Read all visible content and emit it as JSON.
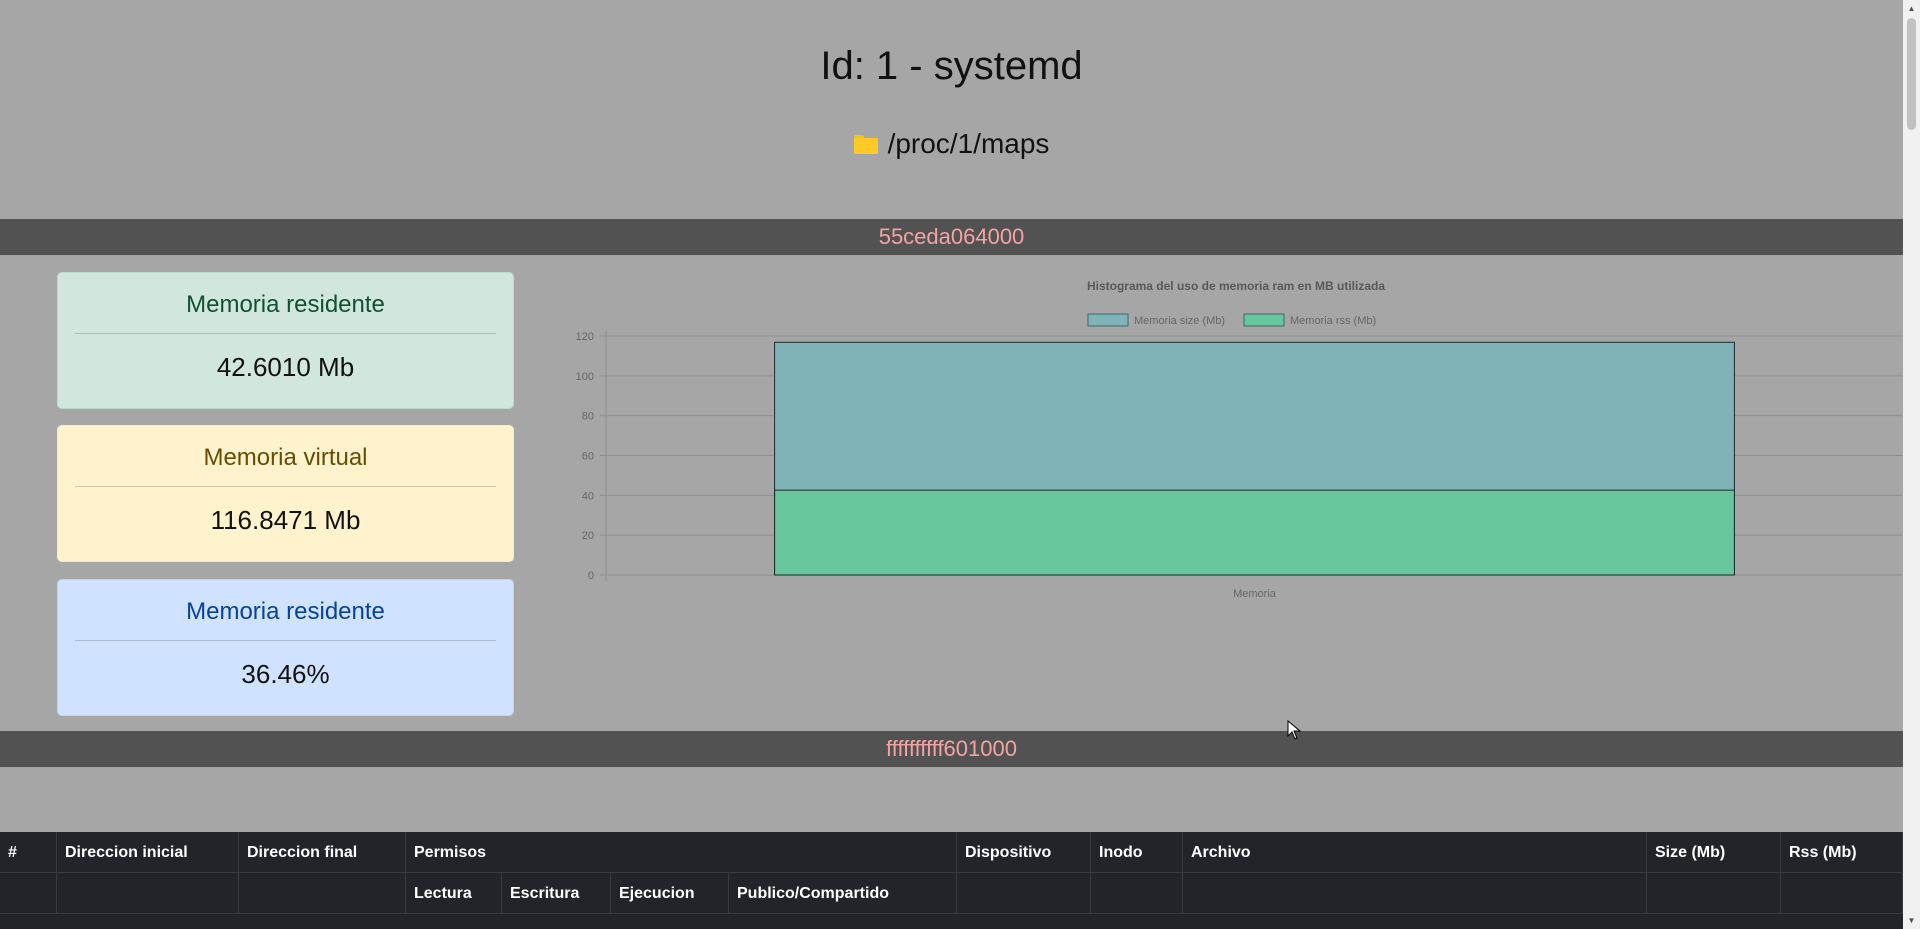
{
  "header": {
    "title": "Id: 1 - systemd",
    "path": "/proc/1/maps",
    "path_icon": "folder-icon"
  },
  "sections": {
    "first_address": "55ceda064000",
    "second_address": "ffffffffff601000"
  },
  "cards": [
    {
      "title": "Memoria residente",
      "value": "42.6010 Mb",
      "color": "#d1e7dd"
    },
    {
      "title": "Memoria virtual",
      "value": "116.8471 Mb",
      "color": "#fff3cd"
    },
    {
      "title": "Memoria residente",
      "value": "36.46%",
      "color": "#cfe2ff"
    }
  ],
  "chart_data": {
    "type": "bar",
    "title": "Histograma del uso de memoria ram en MB utilizada",
    "categories": [
      "Memoria"
    ],
    "series": [
      {
        "name": "Memoria size (Mb)",
        "values": [
          116.8471
        ],
        "color": "#7fb3b8"
      },
      {
        "name": "Memoria rss (Mb)",
        "values": [
          42.601
        ],
        "color": "#67c69b"
      }
    ],
    "overlapping": true,
    "ylim": [
      0,
      120
    ],
    "yticks": [
      "0",
      "20",
      "40",
      "60",
      "80",
      "100",
      "120"
    ],
    "legend": "top",
    "grid": true
  },
  "table": {
    "headers": [
      "#",
      "Direccion inicial",
      "Direccion final",
      "Permisos",
      "Dispositivo",
      "Inodo",
      "Archivo",
      "Size (Mb)",
      "Rss (Mb)"
    ],
    "subheaders": [
      "Lectura",
      "Escritura",
      "Ejecucion",
      "Publico/Compartido"
    ]
  }
}
